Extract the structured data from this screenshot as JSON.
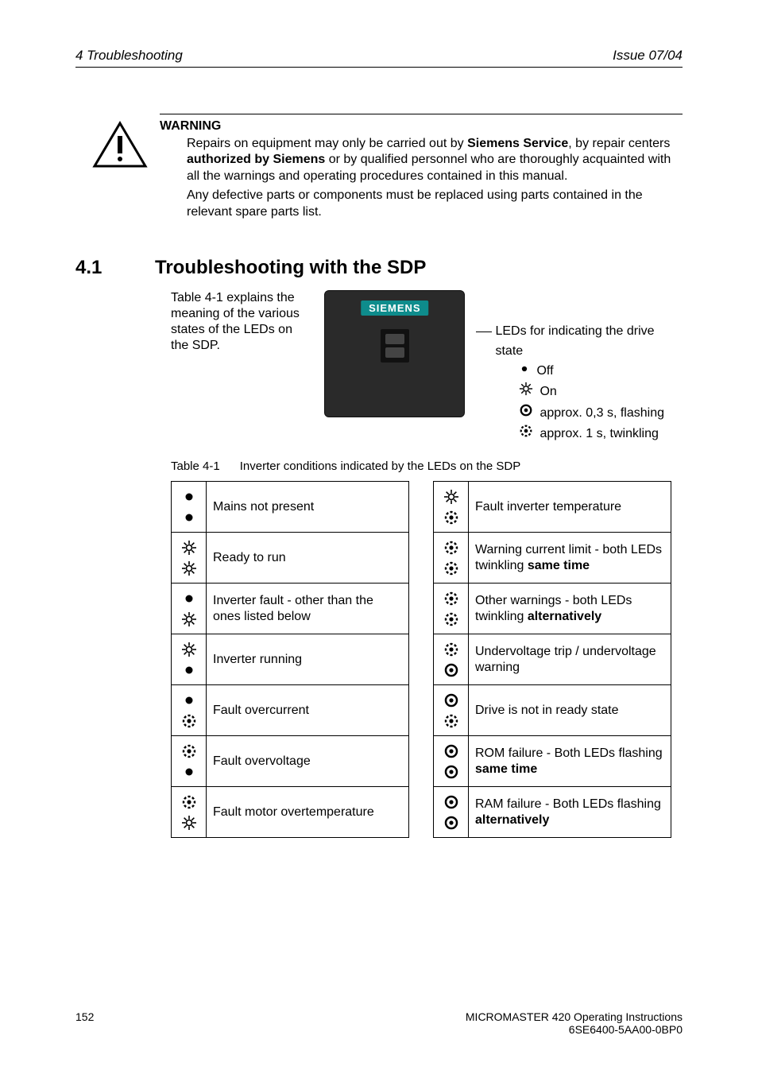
{
  "header": {
    "left": "4  Troubleshooting",
    "right": "Issue 07/04"
  },
  "warning": {
    "title": "WARNING",
    "p1_a": "Repairs on equipment may only be carried out by ",
    "p1_b": "Siemens Service",
    "p1_c": ", by repair centers ",
    "p1_d": "authorized by Siemens",
    "p1_e": " or by qualified personnel who are thoroughly acquainted with all the warnings and operating procedures contained in this manual.",
    "p2": "Any defective parts or components must be replaced using parts contained in the relevant spare parts list."
  },
  "section": {
    "num": "4.1",
    "title": "Troubleshooting with the SDP"
  },
  "intro": "Table 4-1 explains the meaning of the various states of the LEDs on the SDP.",
  "siemens_logo": "SIEMENS",
  "legend": {
    "heading": "LEDs for indicating the drive state",
    "off": "Off",
    "on": "On",
    "flash": "approx. 0,3 s, flashing",
    "twinkle": "approx. 1 s, twinkling"
  },
  "table_caption": {
    "label": "Table 4-1",
    "desc": "Inverter conditions indicated by the LEDs on the SDP"
  },
  "left_rows": [
    {
      "top": "off",
      "bot": "off",
      "text": "Mains not present"
    },
    {
      "top": "on",
      "bot": "on",
      "text": "Ready to run"
    },
    {
      "top": "off",
      "bot": "on",
      "text": "Inverter fault - other than the ones listed below"
    },
    {
      "top": "on",
      "bot": "off",
      "text": "Inverter running"
    },
    {
      "top": "off",
      "bot": "twinkle",
      "text": "Fault overcurrent"
    },
    {
      "top": "twinkle",
      "bot": "off",
      "text": "Fault overvoltage"
    },
    {
      "top": "twinkle",
      "bot": "on",
      "text": "Fault motor overtemperature"
    }
  ],
  "right_rows": [
    {
      "top": "on",
      "bot": "twinkle",
      "text_a": "Fault inverter temperature",
      "text_b": ""
    },
    {
      "top": "twinkle",
      "bot": "twinkle",
      "text_a": "Warning current limit - both LEDs twinkling ",
      "text_b": "same time"
    },
    {
      "top": "twinkle",
      "bot": "twinkle",
      "text_a": "Other warnings - both LEDs twinkling ",
      "text_b": "alternatively"
    },
    {
      "top": "twinkle",
      "bot": "flash",
      "text_a": "Undervoltage trip / undervoltage warning",
      "text_b": ""
    },
    {
      "top": "flash",
      "bot": "twinkle",
      "text_a": "Drive is not in ready state",
      "text_b": ""
    },
    {
      "top": "flash",
      "bot": "flash",
      "text_a": "ROM failure - Both LEDs flashing ",
      "text_b": "same time"
    },
    {
      "top": "flash",
      "bot": "flash",
      "text_a": "RAM failure - Both LEDs flashing ",
      "text_b": "alternatively"
    }
  ],
  "footer": {
    "page": "152",
    "line1": "MICROMASTER 420    Operating Instructions",
    "line2": "6SE6400-5AA00-0BP0"
  }
}
